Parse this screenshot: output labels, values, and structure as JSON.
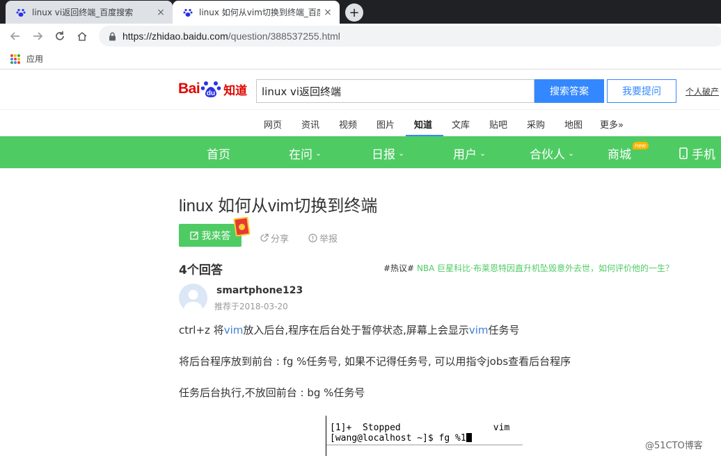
{
  "browser": {
    "tabs": [
      {
        "title": "linux vi返回终端_百度搜索",
        "close": "×"
      },
      {
        "title": "linux 如何从vim切换到终端_百度",
        "close": "×"
      }
    ],
    "new_tab": "+",
    "url_host": "https://zhidao.baidu.com",
    "url_path": "/question/388537255.html",
    "bookmarks_apps": "应用",
    "apps_colors": [
      "#ea4335",
      "#fbbc05",
      "#34a853",
      "#4285f4",
      "#ea4335",
      "#fbbc05",
      "#34a853",
      "#4285f4",
      "#ea4335"
    ]
  },
  "header": {
    "logo_bai": "Bai",
    "logo_du": "du",
    "logo_zhidao": "知道",
    "search_value": "linux vi返回终端",
    "search_button": "搜索答案",
    "ask_button": "我要提问",
    "personal": "个人破产"
  },
  "subnav": [
    "网页",
    "资讯",
    "视频",
    "图片",
    "知道",
    "文库",
    "贴吧",
    "采购",
    "地图",
    "更多»"
  ],
  "greenbar": {
    "items": [
      "首页",
      "在问",
      "日报",
      "用户",
      "合伙人",
      "商城",
      "手机"
    ],
    "new_badge": "new",
    "chevron": "⌄"
  },
  "question": {
    "title": "linux 如何从vim切换到终端",
    "answer_button": "我来答",
    "share": "分享",
    "report": "举报"
  },
  "answers": {
    "count": "4个回答",
    "hot_tag": "#热议#",
    "hot_text": "NBA 巨星科比·布莱恩特因直升机坠毁意外去世，如何评价他的一生？",
    "username": "smartphone123",
    "date": "推荐于2018-03-20",
    "p1_a": "ctrl+z 将",
    "p1_kw1": "vim",
    "p1_b": "放入后台,程序在后台处于暂停状态,屏幕上会显示",
    "p1_kw2": "vim",
    "p1_c": "任务号",
    "p2": "将后台程序放到前台 : fg %任务号, 如果不记得任务号, 可以用指令jobs查看后台程序",
    "p3": "任务后台执行,不放回前台 : bg %任务号"
  },
  "terminal": {
    "line1": "[1]+  Stopped                 vim",
    "line2": "[wang@localhost ~]$ fg %1"
  },
  "watermark": "@51CTO博客",
  "colors": {
    "green": "#4fcb64",
    "blue": "#3388ff",
    "red": "#e10601"
  }
}
